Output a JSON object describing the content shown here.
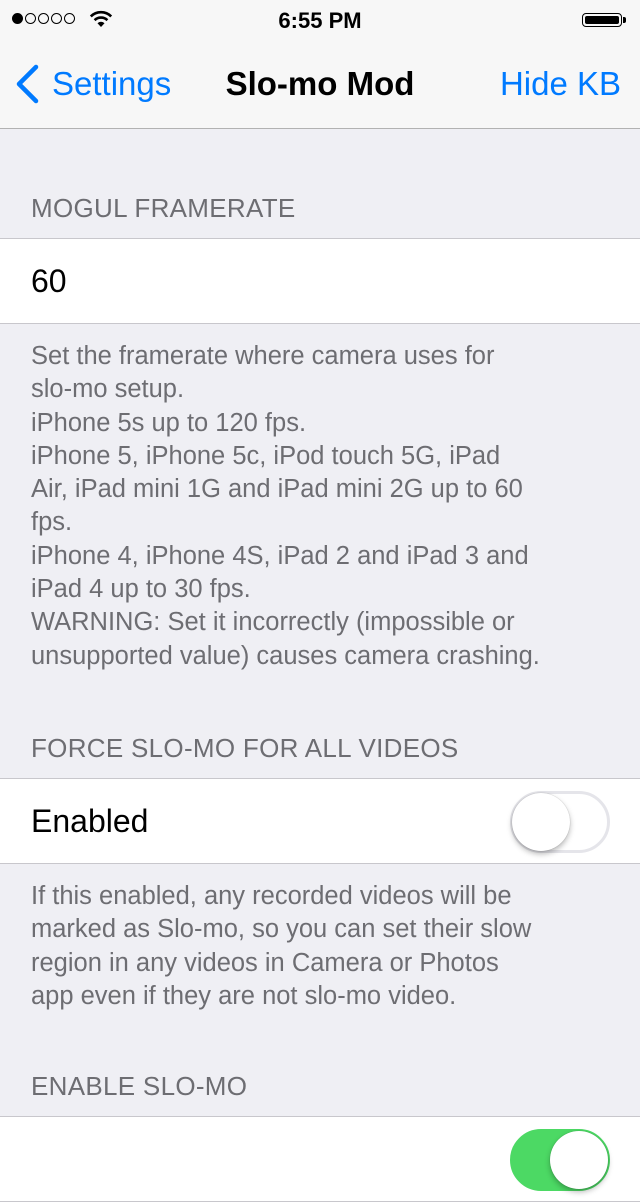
{
  "status_bar": {
    "time": "6:55 PM",
    "signal_bars_filled": 1,
    "signal_bars_total": 5,
    "wifi_icon": "wifi-icon",
    "battery_level": 1.0
  },
  "nav": {
    "back_label": "Settings",
    "title": "Slo-mo Mod",
    "right_label": "Hide KB"
  },
  "sections": {
    "framerate": {
      "header": "MOGUL FRAMERATE",
      "value": "60",
      "footer_lines": [
        "Set the framerate where camera uses for",
        "slo-mo setup.",
        "iPhone 5s up to 120 fps.",
        "iPhone 5, iPhone 5c, iPod touch 5G, iPad",
        "Air, iPad mini 1G and iPad mini 2G up to 60",
        "fps.",
        "iPhone 4, iPhone 4S, iPad 2 and iPad 3 and",
        "iPad 4 up to 30 fps.",
        "WARNING: Set it incorrectly (impossible or",
        "unsupported value) causes camera crashing."
      ]
    },
    "force_slomo": {
      "header": "FORCE SLO-MO FOR ALL VIDEOS",
      "label": "Enabled",
      "enabled": false,
      "footer_lines": [
        "If this enabled, any recorded videos will be",
        "marked as Slo-mo, so you can set their slow",
        "region in any videos in Camera or Photos",
        "app even if they are not slo-mo video."
      ]
    },
    "enable_slomo": {
      "header": "ENABLE SLO-MO",
      "enabled": true
    }
  },
  "colors": {
    "accent": "#007aff",
    "switch_on": "#4cd964",
    "background": "#efeff4",
    "footer_text": "#6d6d72"
  }
}
